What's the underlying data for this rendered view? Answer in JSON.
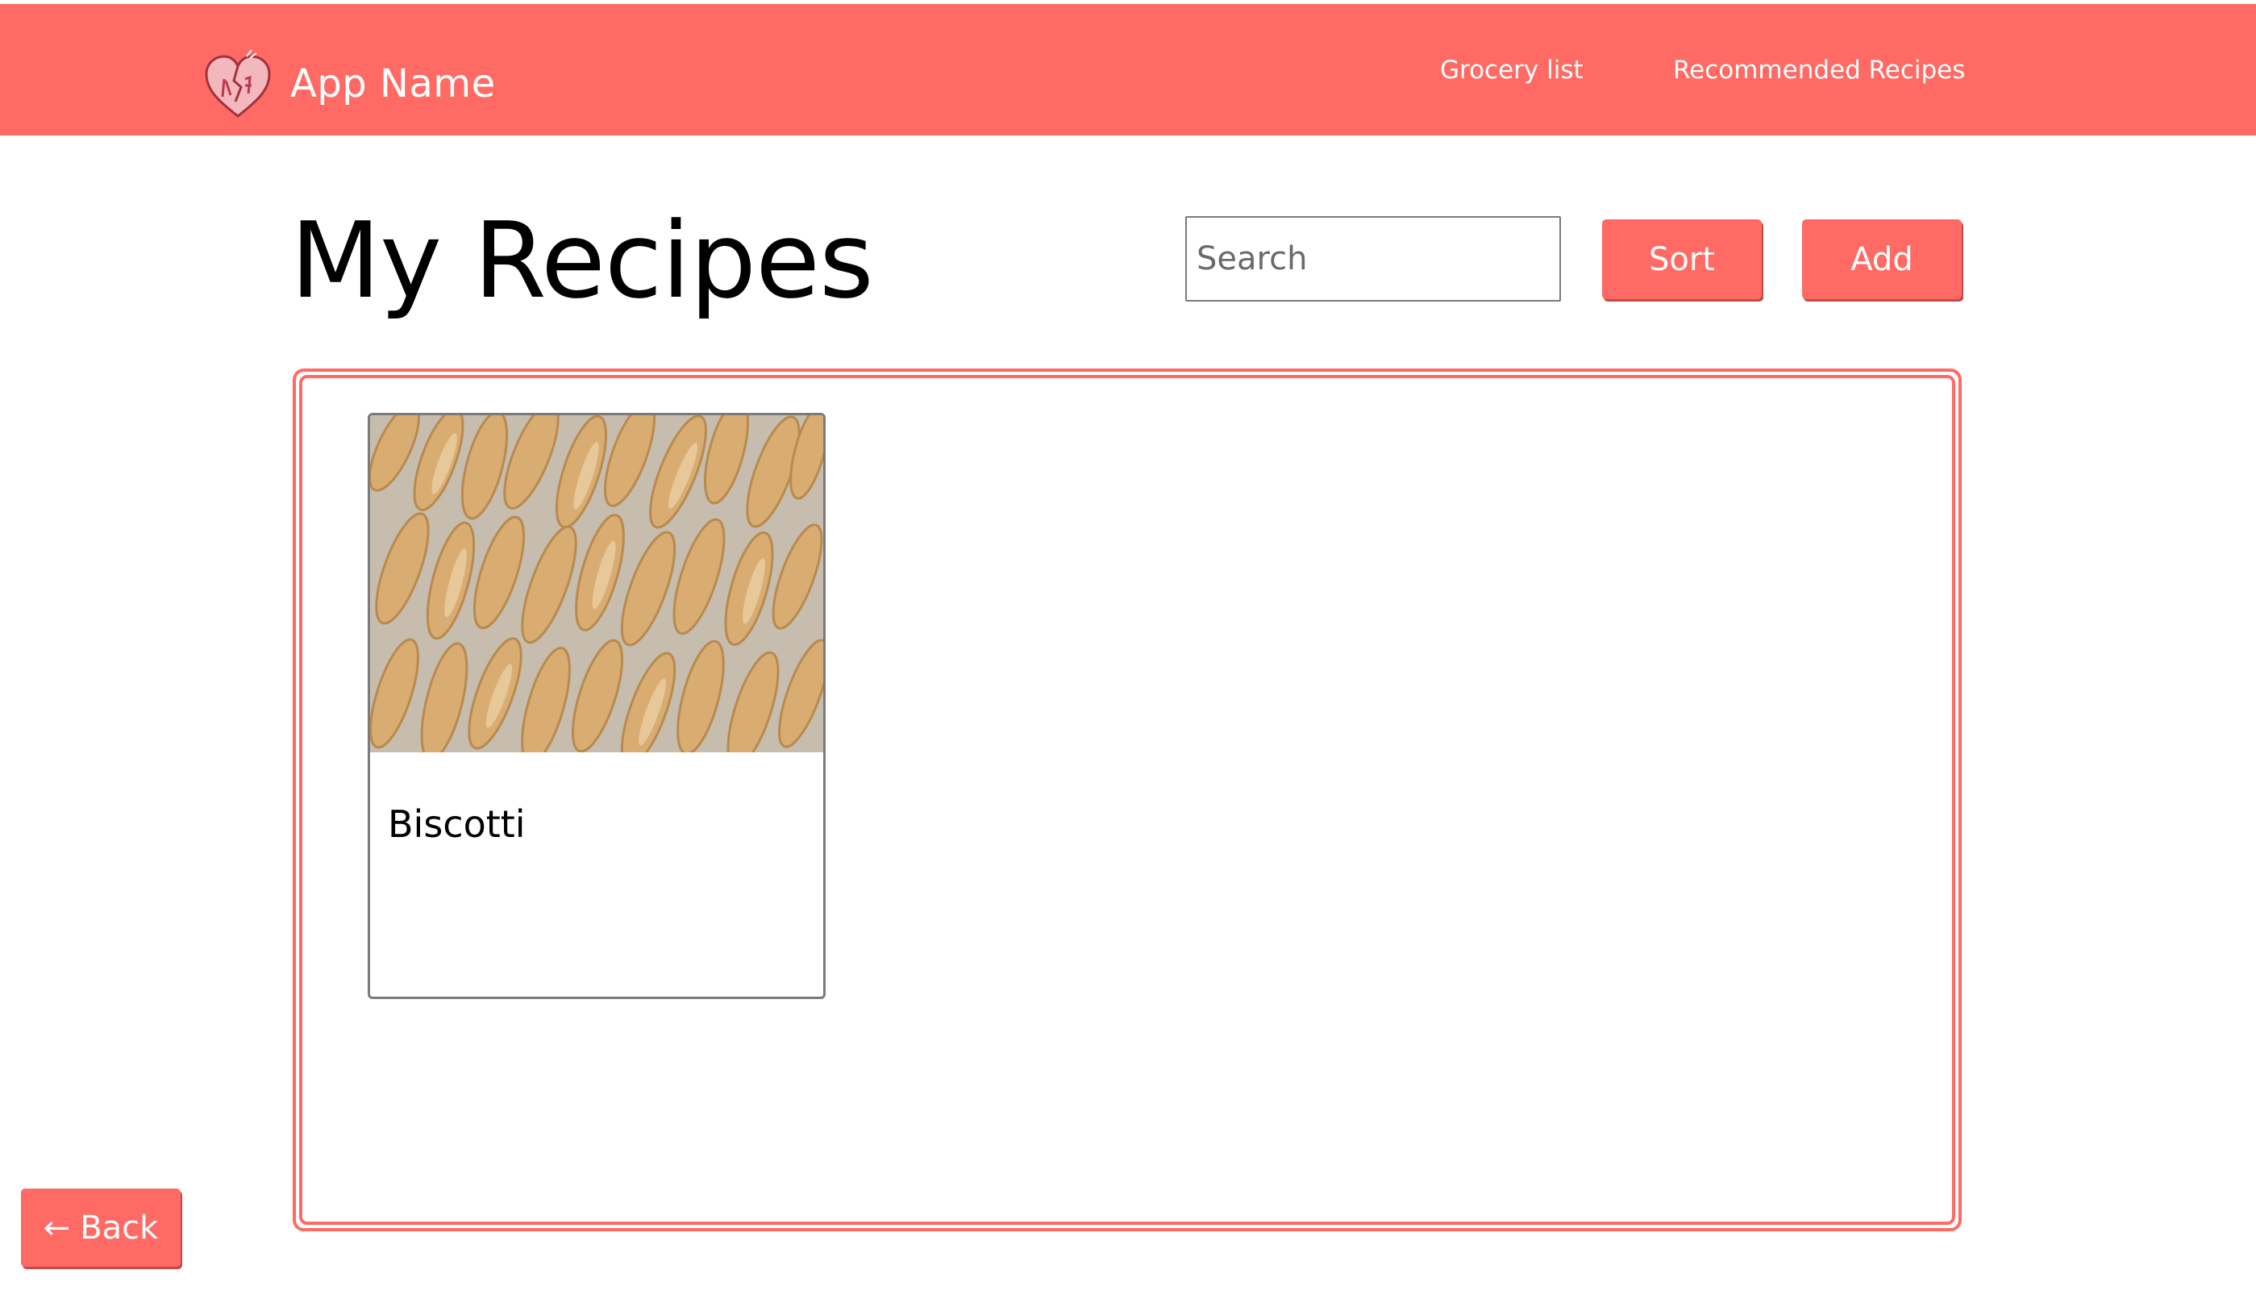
{
  "colors": {
    "accent": "#ff6a64",
    "accent_shadow": "#c24945",
    "page_background": "#ffffff",
    "text": "#000000",
    "nav_text": "#ffffff"
  },
  "navbar": {
    "logo_icon": "heart-logo-icon",
    "app_name": "App Name",
    "links": [
      {
        "label": "Grocery list"
      },
      {
        "label": "Recommended Recipes"
      }
    ]
  },
  "page": {
    "title": "My Recipes"
  },
  "toolbar": {
    "search_placeholder": "Search",
    "search_value": "",
    "sort_label": "Sort",
    "add_label": "Add"
  },
  "recipes": [
    {
      "title": "Biscotti",
      "image": "biscotti-photo"
    }
  ],
  "footer": {
    "back_icon": "arrow-left-icon",
    "back_arrow": "←",
    "back_label": "Back"
  }
}
